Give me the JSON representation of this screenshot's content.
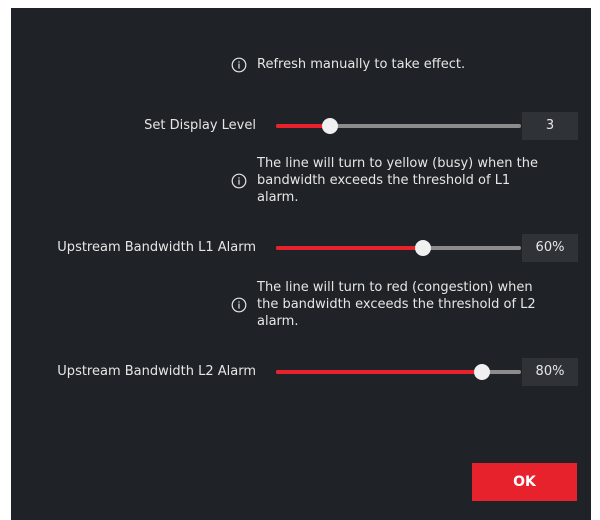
{
  "notes": {
    "refresh": "Refresh manually to take effect.",
    "l1_line1": "The line will turn to yellow (busy) when the",
    "l1_line2": "bandwidth exceeds the threshold of L1",
    "l1_line3": "alarm.",
    "l2_line1": "The line will turn to red (congestion) when",
    "l2_line2": "the bandwidth exceeds the threshold of L2",
    "l2_line3": "alarm."
  },
  "sliders": {
    "display_level": {
      "label": "Set Display Level",
      "value": "3",
      "fraction": 0.22
    },
    "l1_alarm": {
      "label": "Upstream Bandwidth L1 Alarm",
      "value": "60%",
      "fraction": 0.6
    },
    "l2_alarm": {
      "label": "Upstream Bandwidth L2 Alarm",
      "value": "80%",
      "fraction": 0.84
    }
  },
  "buttons": {
    "ok": "OK"
  },
  "icons": {
    "info": "info-circle-icon"
  },
  "colors": {
    "accent": "#e8222d",
    "background": "#1f2226",
    "value_box": "#2f3338"
  }
}
